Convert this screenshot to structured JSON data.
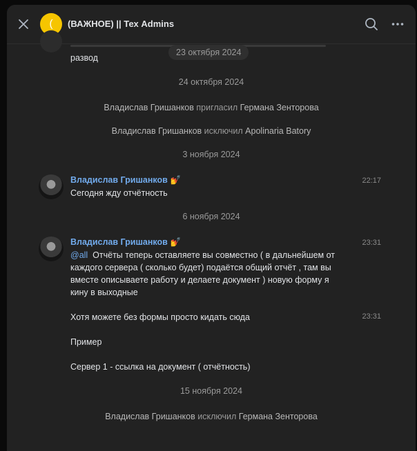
{
  "header": {
    "avatar_letter": "(",
    "title": "(ВАЖНОЕ) || Тех Admins",
    "close_icon": "close-icon",
    "search_icon": "search-icon",
    "more_icon": "more-icon"
  },
  "colors": {
    "accent": "#71aaeb",
    "avatar_bg": "#f6c500",
    "panel_bg": "#222222",
    "pill_bg": "#2f2f2f"
  },
  "feed": {
    "partial_message": "развод",
    "floating_date": "23 октября 2024",
    "date_1": "24 октября 2024",
    "event_1": {
      "actor": "Владислав Гришанков",
      "action": "пригласил",
      "target": "Германа Зенторова"
    },
    "event_2": {
      "actor": "Владислав Гришанков",
      "action": "исключил",
      "target": "Apolinaria Batory"
    },
    "date_2": "3 ноября 2024",
    "msg_1": {
      "author": "Владислав Гришанков",
      "emoji": "💅",
      "time": "22:17",
      "text": "Сегодня жду отчётность"
    },
    "date_3": "6 ноября 2024",
    "msg_2": {
      "author": "Владислав Гришанков",
      "emoji": "💅",
      "time": "23:31",
      "mention": "@all",
      "line_1": "Отчёты теперь оставляете вы совместно ( в дальнейшем от",
      "line_2": "каждого сервера ( сколько будет) подаётся общий отчёт , там вы",
      "line_3": "вместе описываете работу и делаете документ ) новую форму я",
      "line_4": "кину в выходные"
    },
    "msg_3": {
      "time": "23:31",
      "text": "Хотя можете без формы просто кидать сюда"
    },
    "msg_4": {
      "text": "Пример"
    },
    "msg_5": {
      "text": "Сервер 1 - ссылка на документ ( отчётность)"
    },
    "date_4": "15 ноября 2024",
    "event_3": {
      "actor": "Владислав Гришанков",
      "action": "исключил",
      "target": "Германа Зенторова"
    }
  }
}
